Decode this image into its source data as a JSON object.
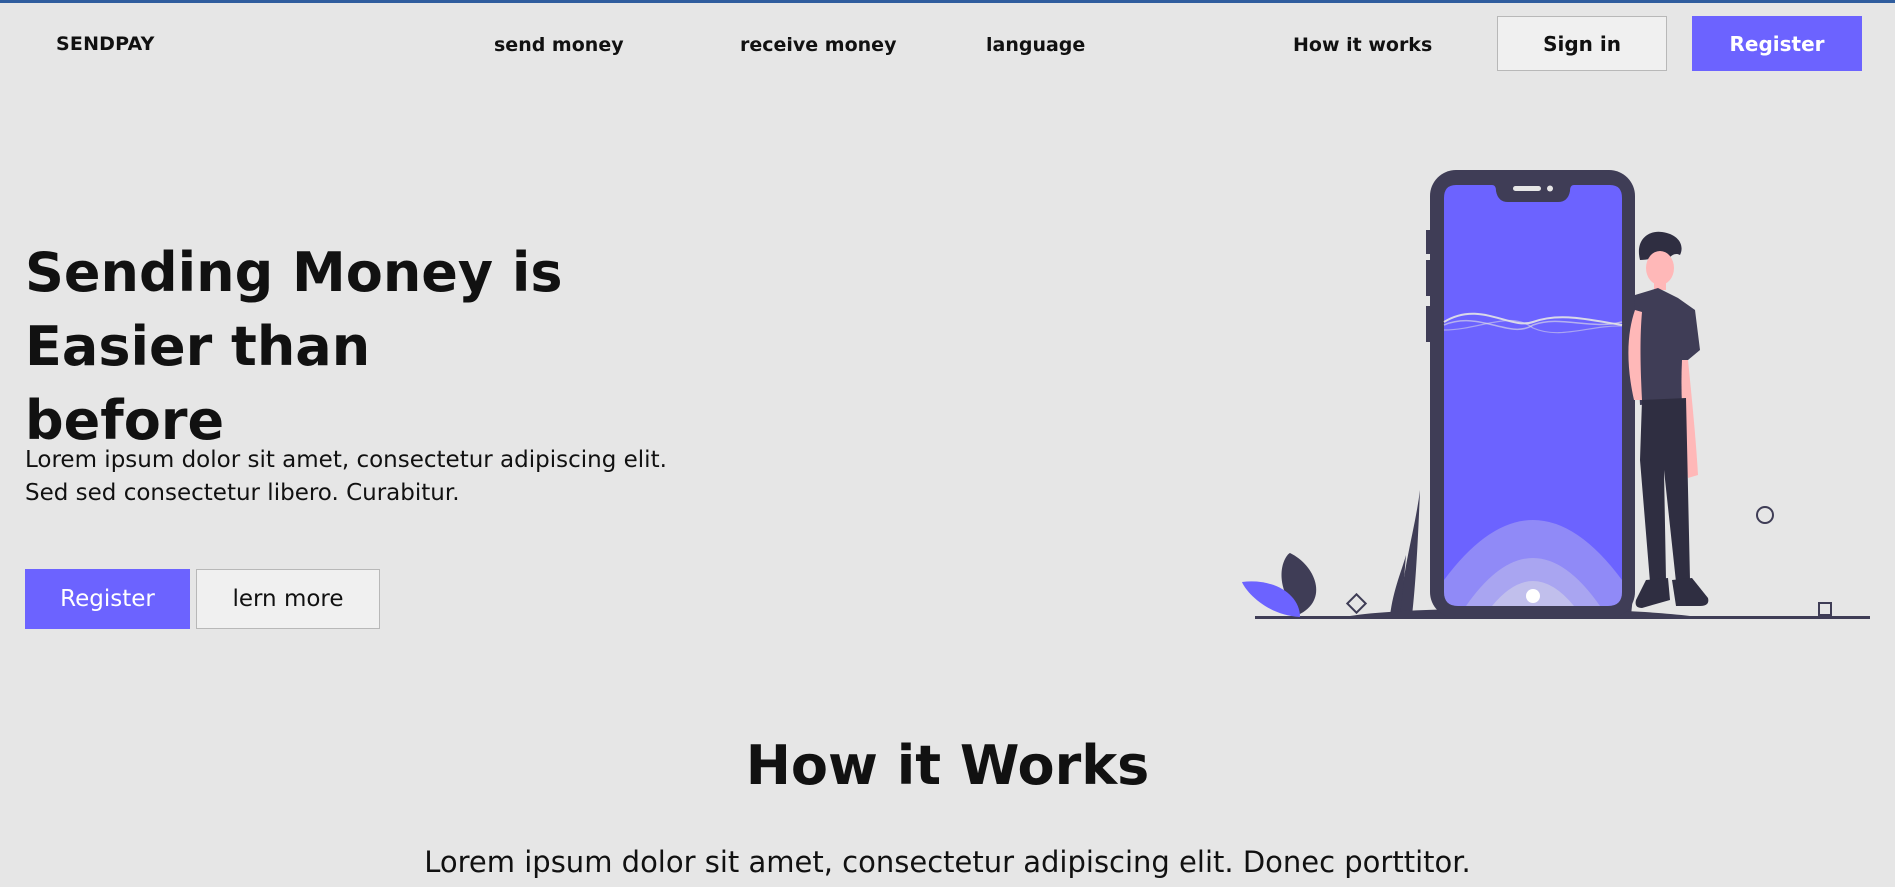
{
  "nav": {
    "brand": "SENDPAY",
    "links": [
      "send money",
      "receive money",
      "language",
      "How it works"
    ],
    "sign_in": "Sign in",
    "register": "Register"
  },
  "hero": {
    "title_line1": "Sending Money is",
    "title_line2": "Easier than before",
    "subtitle_line1": "Lorem ipsum dolor sit amet, consectetur adipiscing elit.",
    "subtitle_line2": "Sed sed consectetur libero. Curabitur.",
    "register": "Register",
    "learn_more": "lern more"
  },
  "how_it_works": {
    "title": "How it Works",
    "subtitle": "Lorem ipsum dolor sit amet, consectetur adipiscing elit. Donec porttitor."
  },
  "colors": {
    "accent": "#6c63ff",
    "background": "#e6e6e6",
    "dark": "#3f3d56",
    "skin": "#ffb8b8"
  },
  "icons": {
    "illustration": "person-with-phone-illustration"
  }
}
